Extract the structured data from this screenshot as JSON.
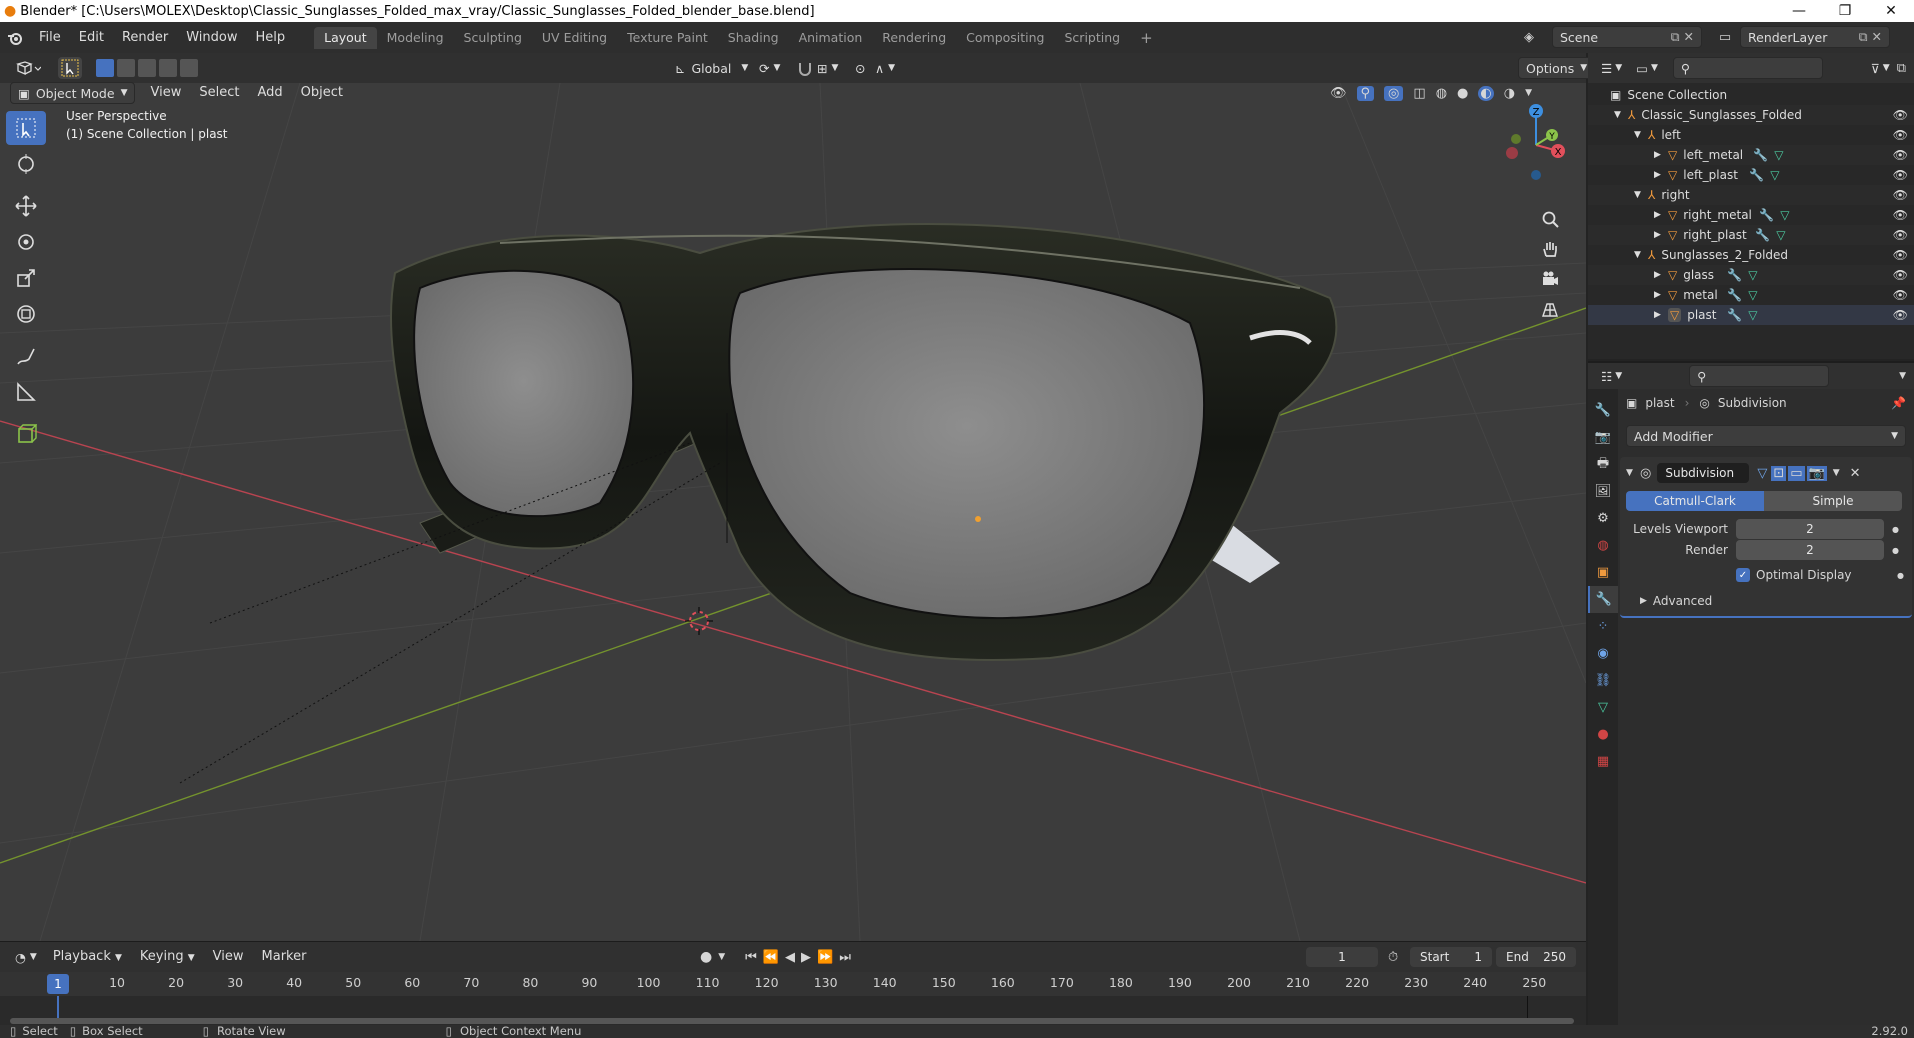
{
  "window": {
    "title": "Blender* [C:\\Users\\MOLEX\\Desktop\\Classic_Sunglasses_Folded_max_vray/Classic_Sunglasses_Folded_blender_base.blend]"
  },
  "menus": [
    "File",
    "Edit",
    "Render",
    "Window",
    "Help"
  ],
  "workspaces": [
    {
      "label": "Layout",
      "active": true
    },
    {
      "label": "Modeling"
    },
    {
      "label": "Sculpting"
    },
    {
      "label": "UV Editing"
    },
    {
      "label": "Texture Paint"
    },
    {
      "label": "Shading"
    },
    {
      "label": "Animation"
    },
    {
      "label": "Rendering"
    },
    {
      "label": "Compositing"
    },
    {
      "label": "Scripting"
    }
  ],
  "scene": {
    "name": "Scene",
    "render_layer": "RenderLayer"
  },
  "viewport_header": {
    "transform_orientation": "Global",
    "options_label": "Options",
    "mode": "Object Mode",
    "menus": [
      "View",
      "Select",
      "Add",
      "Object"
    ]
  },
  "viewport": {
    "perspective_label": "User Perspective",
    "collection_label": "(1) Scene Collection | plast",
    "gizmo_axes": {
      "z": "Z",
      "x": "X",
      "y": "Y"
    }
  },
  "outliner": {
    "root": "Scene Collection",
    "rows": [
      {
        "label": "Classic_Sunglasses_Folded",
        "kind": "collection"
      },
      {
        "label": "left",
        "kind": "group"
      },
      {
        "label": "left_metal",
        "kind": "mesh"
      },
      {
        "label": "left_plast",
        "kind": "mesh"
      },
      {
        "label": "right",
        "kind": "group"
      },
      {
        "label": "right_metal",
        "kind": "mesh"
      },
      {
        "label": "right_plast",
        "kind": "mesh"
      },
      {
        "label": "Sunglasses_2_Folded",
        "kind": "group"
      },
      {
        "label": "glass",
        "kind": "mesh"
      },
      {
        "label": "metal",
        "kind": "mesh"
      },
      {
        "label": "plast",
        "kind": "mesh",
        "selected": true
      }
    ]
  },
  "properties": {
    "object_name": "plast",
    "modifier_tab": "Subdivision",
    "add_modifier_label": "Add Modifier",
    "modifier_name": "Subdivision",
    "algorithms": [
      {
        "label": "Catmull-Clark",
        "active": true
      },
      {
        "label": "Simple"
      }
    ],
    "levels_viewport_label": "Levels Viewport",
    "levels_viewport_value": "2",
    "render_label": "Render",
    "render_value": "2",
    "optimal_display_label": "Optimal Display",
    "optimal_display_checked": true,
    "advanced_label": "Advanced"
  },
  "timeline": {
    "menus": [
      "Playback",
      "Keying",
      "View",
      "Marker"
    ],
    "current_frame": "1",
    "start_label": "Start",
    "start_value": "1",
    "end_label": "End",
    "end_value": "250",
    "ruler_ticks": [
      "10",
      "20",
      "30",
      "40",
      "50",
      "60",
      "70",
      "80",
      "90",
      "100",
      "110",
      "120",
      "130",
      "140",
      "150",
      "160",
      "170",
      "180",
      "190",
      "200",
      "210",
      "220",
      "230",
      "240",
      "250"
    ],
    "playhead_label": "1"
  },
  "statusbar": {
    "select": "Select",
    "box_select": "Box Select",
    "rotate_view": "Rotate View",
    "context_menu": "Object Context Menu",
    "version": "2.92.0"
  },
  "colors": {
    "accent": "#4672bf",
    "axis_x": "#e14f5b",
    "axis_y": "#8bc34a",
    "axis_z": "#3d8fe0",
    "mesh_icon": "#f09a3e",
    "viewport_bg": "#3c3c3c"
  }
}
